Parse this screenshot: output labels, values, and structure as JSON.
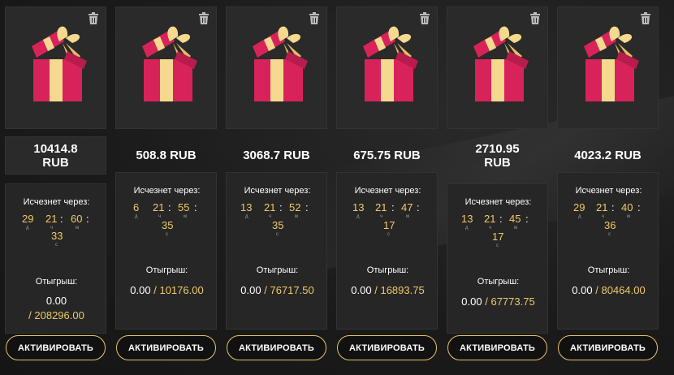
{
  "colors": {
    "accent": "#f0c96a",
    "button_border": "#e8c36a",
    "gift_red": "#d8235a",
    "gift_ribbon": "#f5d98e"
  },
  "icons": {
    "delete": "trash-icon",
    "gift": "gift-box-icon"
  },
  "cards": [
    {
      "amount": "10414.8 RUB",
      "timer_label": "Исчезнет через:",
      "timer": {
        "days": "29",
        "hours": "21",
        "minutes": "60",
        "seconds": "33"
      },
      "play_label": "Отыгрыш:",
      "play_current": "0.00",
      "play_target": "/ 208296.00",
      "button": "АКТИВИРОВАТЬ"
    },
    {
      "amount": "508.8 RUB",
      "timer_label": "Исчезнет через:",
      "timer": {
        "days": "6",
        "hours": "21",
        "minutes": "55",
        "seconds": "35"
      },
      "play_label": "Отыгрыш:",
      "play_current": "0.00",
      "play_target": "/ 10176.00",
      "button": "АКТИВИРОВАТЬ"
    },
    {
      "amount": "3068.7 RUB",
      "timer_label": "Исчезнет через:",
      "timer": {
        "days": "13",
        "hours": "21",
        "minutes": "52",
        "seconds": "35"
      },
      "play_label": "Отыгрыш:",
      "play_current": "0.00",
      "play_target": "/ 76717.50",
      "button": "АКТИВИРОВАТЬ"
    },
    {
      "amount": "675.75 RUB",
      "timer_label": "Исчезнет через:",
      "timer": {
        "days": "13",
        "hours": "21",
        "minutes": "47",
        "seconds": "17"
      },
      "play_label": "Отыгрыш:",
      "play_current": "0.00",
      "play_target": "/ 16893.75",
      "button": "АКТИВИРОВАТЬ"
    },
    {
      "amount": "2710.95 RUB",
      "timer_label": "Исчезнет через:",
      "timer": {
        "days": "13",
        "hours": "21",
        "minutes": "45",
        "seconds": "17"
      },
      "play_label": "Отыгрыш:",
      "play_current": "0.00",
      "play_target": "/ 67773.75",
      "button": "АКТИВИРОВАТЬ"
    },
    {
      "amount": "4023.2 RUB",
      "timer_label": "Исчезнет через:",
      "timer": {
        "days": "29",
        "hours": "21",
        "minutes": "40",
        "seconds": "36"
      },
      "play_label": "Отыгрыш:",
      "play_current": "0.00",
      "play_target": "/ 80464.00",
      "button": "АКТИВИРОВАТЬ"
    }
  ],
  "units": {
    "days": "д",
    "hours": "ч",
    "minutes": "м",
    "seconds": "с"
  }
}
